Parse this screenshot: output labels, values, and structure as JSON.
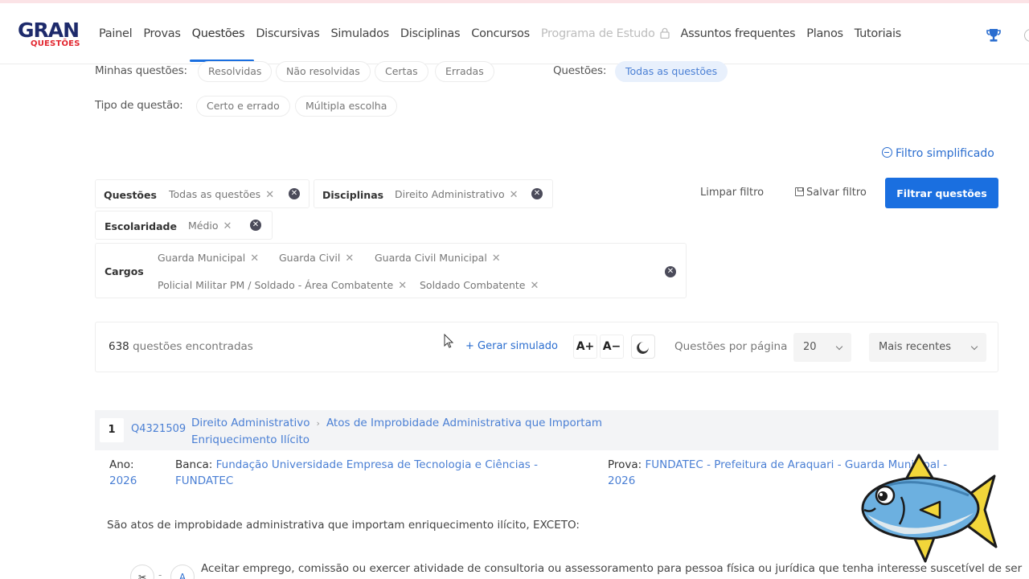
{
  "brand": {
    "gran": "GRAN",
    "questoes": "QUESTÕES"
  },
  "nav": {
    "items": [
      {
        "label": "Painel"
      },
      {
        "label": "Provas"
      },
      {
        "label": "Questões"
      },
      {
        "label": "Discursivas"
      },
      {
        "label": "Simulados"
      },
      {
        "label": "Disciplinas"
      },
      {
        "label": "Concursos"
      },
      {
        "label": "Programa de Estudo"
      },
      {
        "label": "Assuntos frequentes"
      },
      {
        "label": "Planos"
      },
      {
        "label": "Tutoriais"
      }
    ],
    "active": "Questões",
    "disabled": "Programa de Estudo"
  },
  "filters": {
    "minhas_label": "Minhas questões:",
    "minhas_options": [
      "Resolvidas",
      "Não resolvidas",
      "Certas",
      "Erradas"
    ],
    "questoes_label": "Questões:",
    "questoes_selected": "Todas as questões",
    "tipo_label": "Tipo de questão:",
    "tipo_options": [
      "Certo e errado",
      "Múltipla escolha"
    ],
    "simplified_link": "Filtro simplificado"
  },
  "applied": {
    "questoes": {
      "title": "Questões",
      "tags": [
        "Todas as questões"
      ]
    },
    "disciplinas": {
      "title": "Disciplinas",
      "tags": [
        "Direito Administrativo"
      ]
    },
    "escolaridade": {
      "title": "Escolaridade",
      "tags": [
        "Médio"
      ]
    },
    "cargos": {
      "title": "Cargos",
      "tags": [
        "Guarda Municipal",
        "Guarda Civil",
        "Guarda Civil Municipal",
        "Policial Militar PM / Soldado - Área Combatente",
        "Soldado Combatente"
      ]
    },
    "remove_glyph": "✕",
    "clear_glyph": "✕"
  },
  "actions": {
    "limpar": "Limpar filtro",
    "salvar": "Salvar filtro",
    "filtrar": "Filtrar questões"
  },
  "results": {
    "count": "638",
    "count_suffix": "questões encontradas",
    "gerar": "+ Gerar simulado",
    "font_increase": "A+",
    "font_decrease": "A−",
    "per_page_label": "Questões por página",
    "per_page_value": "20",
    "sort_value": "Mais recentes"
  },
  "question": {
    "number": "1",
    "id": "Q4321509",
    "discipline": "Direito Administrativo",
    "path_sep": "›",
    "topic": "Atos de Improbidade Administrativa que Importam Enriquecimento Ilícito",
    "ano_label": "Ano:",
    "ano": "2026",
    "banca_label": "Banca:",
    "banca": "Fundação Universidade Empresa de Tecnologia e Ciências - FUNDATEC",
    "prova_label": "Prova:",
    "prova": "FUNDATEC - Prefeitura de Araquari - Guarda Municipal - 2026",
    "statement": "São atos de improbidade administrativa que importam enriquecimento ilícito, EXCETO:",
    "alt_scissors": "✂",
    "alt_dash": "-",
    "alt_letter": "A",
    "alt_text": "Aceitar emprego, comissão ou exercer atividade de consultoria ou assessoramento para pessoa física ou jurídica que tenha interesse suscetível de ser"
  },
  "colors": {
    "primary": "#1a6fe0",
    "link": "#4a7fd4",
    "brand_navy": "#1d2a6b",
    "brand_red": "#e2262f"
  }
}
